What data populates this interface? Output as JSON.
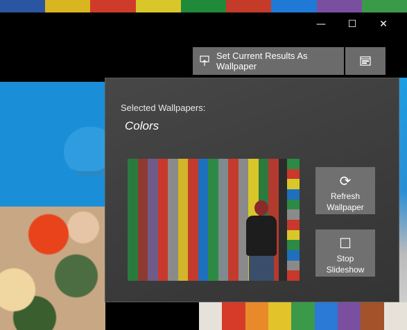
{
  "window_controls": {
    "minimize": "—",
    "maximize": "☐",
    "close": "✕"
  },
  "toolbar": {
    "set_wallpaper_label": "Set Current Results As Wallpaper",
    "set_wallpaper_icon": "wallpaper-upload-icon",
    "slideshow_icon": "slideshow-icon"
  },
  "panel": {
    "label": "Selected Wallpapers:",
    "selection_name": "Colors",
    "refresh_button": {
      "line1": "Refresh",
      "line2": "Wallpaper",
      "icon": "refresh-icon"
    },
    "stop_button": {
      "line1": "Stop",
      "line2": "Slideshow",
      "icon": "stop-icon"
    }
  },
  "colors": {
    "panel_bg": "#404040",
    "button_bg": "#707070",
    "accent_blue": "#1a8fd8"
  }
}
